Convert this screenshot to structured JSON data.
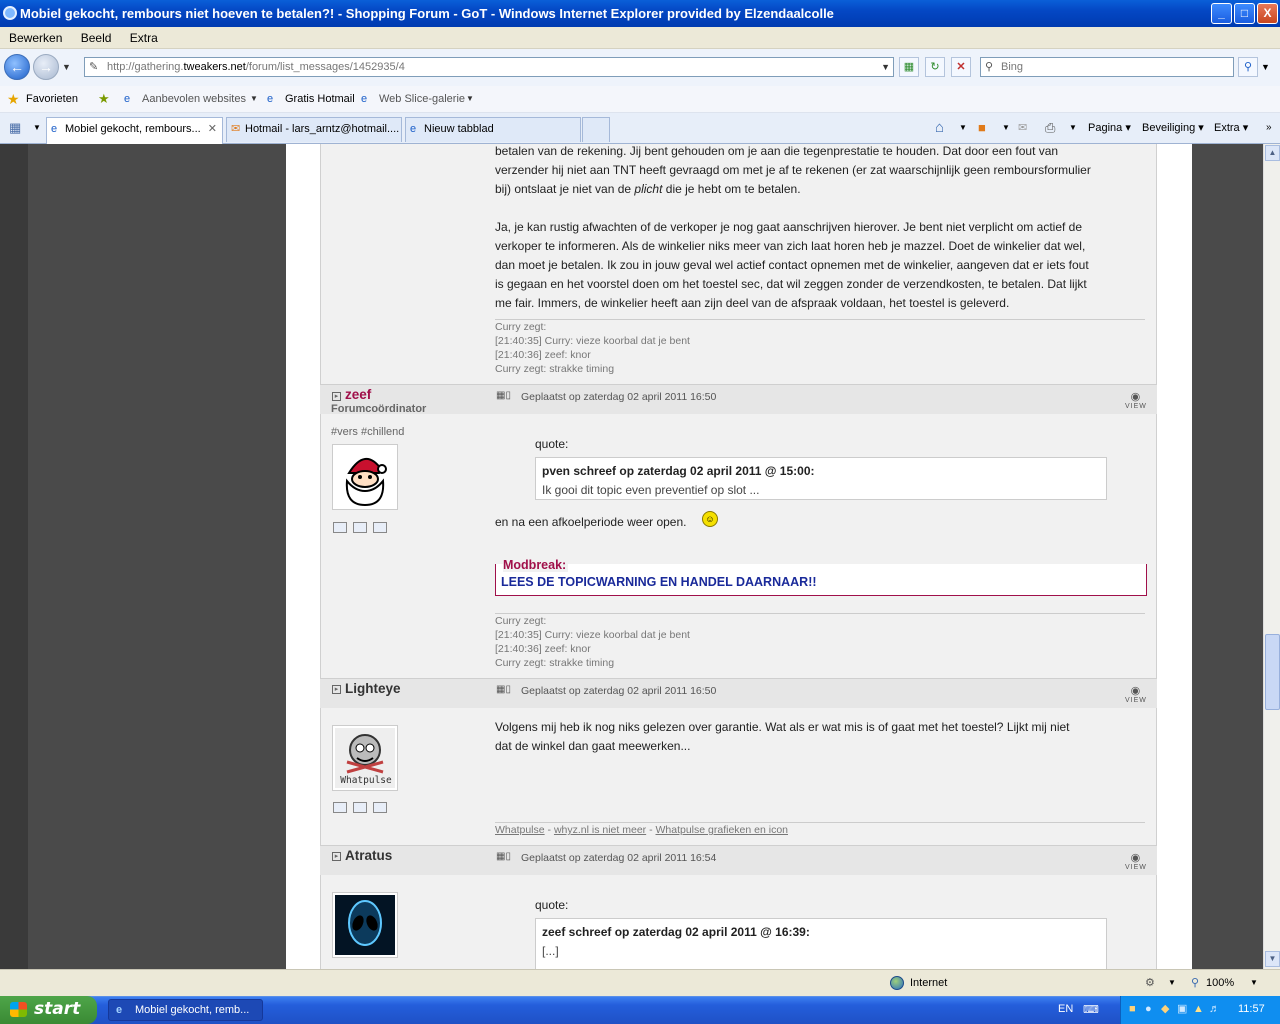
{
  "window": {
    "title": "Mobiel gekocht, rembours niet hoeven te betalen?! - Shopping Forum - GoT - Windows Internet Explorer provided by Elzendaalcolle",
    "minimize": "_",
    "maximize": "□",
    "close": "X"
  },
  "menu": [
    "Bewerken",
    "Beeld",
    "Extra"
  ],
  "address": {
    "prefix": "http://gathering.",
    "domain": "tweakers.net",
    "path": "/forum/list_messages/1452935/4",
    "search_placeholder": "Bing"
  },
  "favorites": {
    "label": "Favorieten",
    "items": [
      "Aanbevolen websites",
      "Gratis Hotmail",
      "Web Slice-galerie"
    ]
  },
  "tabs": [
    {
      "label": "Mobiel gekocht, rembours..."
    },
    {
      "label": "Hotmail - lars_arntz@hotmail...."
    },
    {
      "label": "Nieuw tabblad"
    }
  ],
  "commandbar": [
    "Pagina",
    "Beveiliging",
    "Extra"
  ],
  "post1": {
    "paragraph1_lines": [
      "betalen van de rekening. Jij bent gehouden om je aan die tegenprestatie te houden. Dat door een fout van",
      "verzender hij niet aan TNT heeft gevraagd om met je af te rekenen (er zat waarschijnlijk geen remboursformulier",
      "bij) ontslaat je niet van de plicht die je hebt om te betalen."
    ],
    "paragraph2_lines": [
      "Ja, je kan rustig afwachten of de verkoper je nog gaat aanschrijven hierover. Je bent niet verplicht om actief de",
      "verkoper te informeren. Als de winkelier niks meer van zich laat horen heb je mazzel. Doet de winkelier dat wel,",
      "dan moet je betalen. Ik zou in jouw geval wel actief contact opnemen met de winkelier, aangeven dat er iets fout",
      "is gegaan en het voorstel doen om het toestel sec, dat wil zeggen zonder de verzendkosten, te betalen. Dat lijkt",
      "me fair. Immers, de winkelier heeft aan zijn deel van de afspraak voldaan, het toestel is geleverd."
    ],
    "signature": [
      "Curry zegt:",
      "[21:40:35] Curry: vieze koorbal dat je bent",
      "[21:40:36] zeef: knor",
      "Curry zegt: strakke timing"
    ]
  },
  "post2": {
    "username": "zeef",
    "role": "Forumcoördinator",
    "tags": "#vers #chillend",
    "posted": "Geplaatst op zaterdag 02 april 2011 16:50",
    "view": "VIEW",
    "quote_label": "quote:",
    "quote_author": "pven schreef op zaterdag 02 april 2011 @ 15:00:",
    "quote_text": "Ik gooi dit topic even preventief op slot ...",
    "body": "en na een afkoelperiode weer open.",
    "modbreak_label": "Modbreak:",
    "modbreak_text": "LEES DE TOPICWARNING EN HANDEL DAARNAAR!!",
    "signature": [
      "Curry zegt:",
      "[21:40:35] Curry: vieze koorbal dat je bent",
      "[21:40:36] zeef: knor",
      "Curry zegt: strakke timing"
    ]
  },
  "post3": {
    "username": "Lighteye",
    "posted": "Geplaatst op zaterdag 02 april 2011 16:50",
    "view": "VIEW",
    "avatar_text": "Whatpulse",
    "body_lines": [
      "Volgens mij heb ik nog niks gelezen over garantie. Wat als er wat mis is of gaat met het toestel? Lijkt mij niet",
      "dat de winkel dan gaat meewerken..."
    ],
    "sig_links": [
      "Whatpulse",
      "whyz.nl is niet meer",
      "Whatpulse grafieken en icon"
    ],
    "sig_sep": "-"
  },
  "post4": {
    "username": "Atratus",
    "posted": "Geplaatst op zaterdag 02 april 2011 16:54",
    "view": "VIEW",
    "quote_label": "quote:",
    "quote_author": "zeef schreef op zaterdag 02 april 2011 @ 16:39:",
    "quote_text": "[...]"
  },
  "status": {
    "zone": "Internet",
    "zoom": "100%"
  },
  "taskbar": {
    "start": "start",
    "task": "Mobiel gekocht, remb...",
    "lang": "EN",
    "time": "11:57"
  }
}
